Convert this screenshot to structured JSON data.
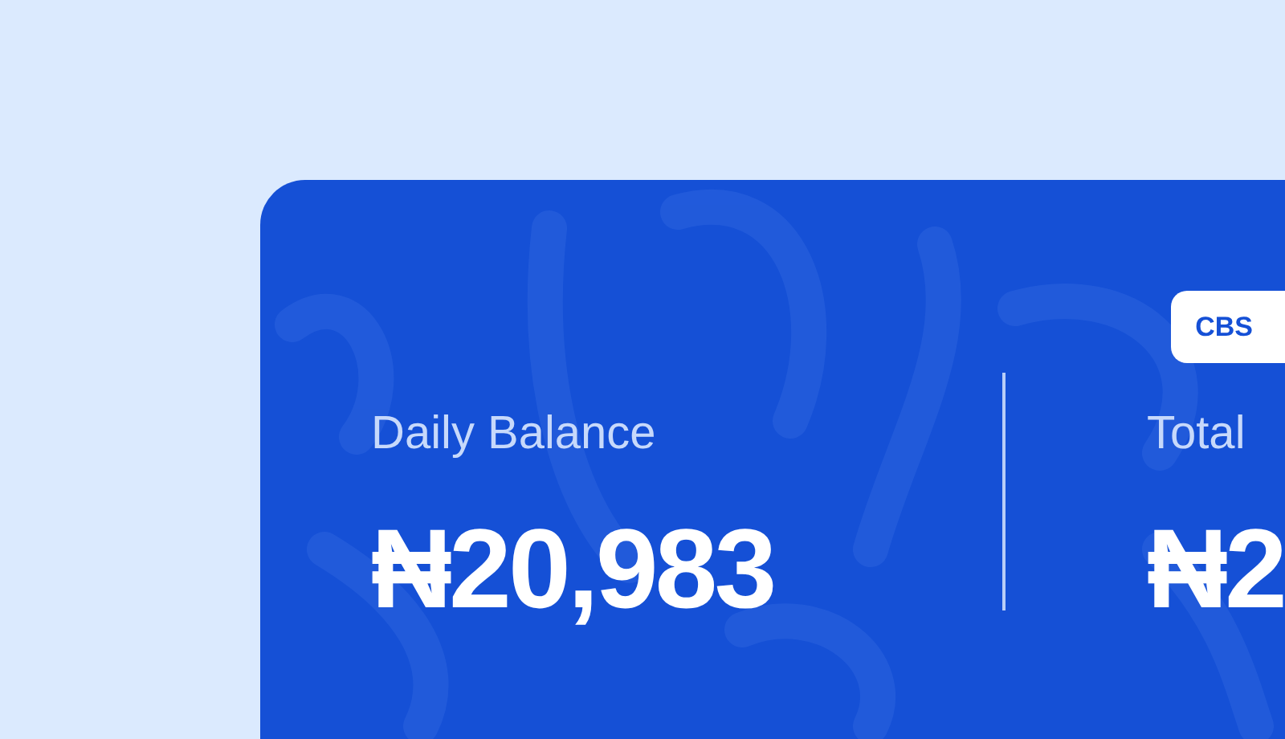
{
  "badge": "CBS",
  "stats": [
    {
      "label": "Daily Balance",
      "amount": "₦20,983"
    },
    {
      "label": "Total",
      "amount": "₦2"
    }
  ]
}
